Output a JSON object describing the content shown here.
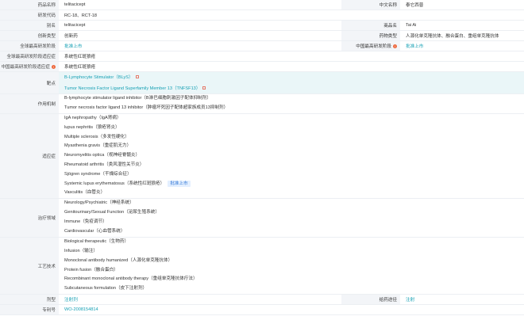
{
  "fields": {
    "drug_name_label": "药品名称",
    "drug_name": "telitacicept",
    "cn_name_label": "中文名称",
    "cn_name": "泰它西普",
    "codes_label": "研发代码",
    "codes": "RC-18、RCT-18",
    "alias_label": "别名",
    "alias": "telitacicept",
    "trade_name_label": "商品名",
    "trade_name": "Tai Ai",
    "innovation_label": "创新类型",
    "innovation": "创新药",
    "drug_type_label": "药物类型",
    "drug_type": "人源化单克隆抗体、融合蛋白、重组单克隆抗体",
    "global_phase_label": "全球最高研发阶段",
    "global_phase": "批准上市",
    "china_phase_label": "中国最高研发阶段",
    "china_phase": "批准上市",
    "global_indication_label": "全球最高研发阶段适应症",
    "global_indication": "系统性红斑狼疮",
    "china_indication_label": "中国最高研发阶段适应症",
    "china_indication": "系统性红斑狼疮",
    "dosage_label": "剂型",
    "dosage": "注射剂",
    "route_label": "给药途径",
    "route": "注射",
    "patent_label": "专利号",
    "patent": "WO-2008154814"
  },
  "target": {
    "label": "靶点",
    "items": [
      "B-Lymphocyte Stimulator（BLyS）",
      "Tumor Necrosis Factor Ligand Superfamily Member 13（TNFSF13）"
    ]
  },
  "mechanism": {
    "label": "作用机制",
    "items": [
      "B-lymphocyte stimulator ligand inhibitor（B淋巴细胞刺激因子配体抑制剂）",
      "Tumor necrosis factor ligand 13 inhibitor（肿瘤坏死因子配体超家族成员13抑制剂）"
    ]
  },
  "indications": {
    "label": "适应症",
    "items": [
      "IgA nephropathy（IgA肾病）",
      "lupus nephritis（狼疮肾炎）",
      "Multiple sclerosis（多发性硬化）",
      "Myasthenia gravis（重症肌无力）",
      "Neuromyelitis optica（视神经脊髓炎）",
      "Rheumatoid arthritis（类风湿性关节炎）",
      "Sjögren syndrome（干燥综合征）",
      "Systemic lupus erythematosus（系统性红斑狼疮）",
      "Vasculitis（血管炎）"
    ],
    "approved_tag": "批准上市"
  },
  "therapy": {
    "label": "治疗领域",
    "items": [
      "Neurology/Psychiatric（神经系统）",
      "Genitourinary/Sexual Function（泌尿生殖系统）",
      "Immune（免疫调节）",
      "Cardiovascular（心血管系统）"
    ]
  },
  "technology": {
    "label": "工艺技术",
    "items": [
      "Biological therapeutic（生物药）",
      "Infusion（输注）",
      "Monoclonal antibody humanized（人源化单克隆抗体）",
      "Protein fusion（融合蛋白）",
      "Recombinant monoclonal antibody therapy（重组单克隆抗体疗法）",
      "Subcutaneous formulation（皮下注射剂）"
    ]
  },
  "colors": {
    "label_bg": "#f3f5f8",
    "link": "#16a0b4",
    "target_bg": "#eaf6f8",
    "badge": "#ee6a3f"
  }
}
